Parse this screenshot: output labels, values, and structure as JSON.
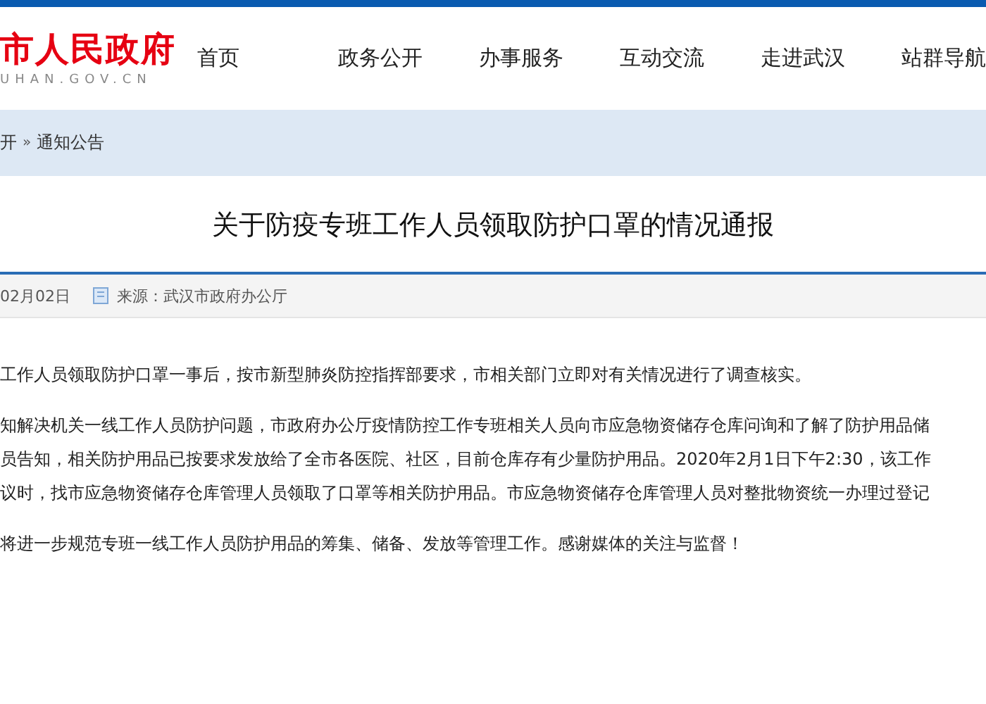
{
  "header": {
    "logo_title": "市人民政府",
    "logo_domain": "UHAN.GOV.CN",
    "nav": [
      {
        "label": "首页"
      },
      {
        "label": "政务公开"
      },
      {
        "label": "办事服务"
      },
      {
        "label": "互动交流"
      },
      {
        "label": "走进武汉"
      },
      {
        "label": "站群导航"
      }
    ]
  },
  "breadcrumb": [
    "开",
    "通知公告"
  ],
  "breadcrumb_separator": "»",
  "article": {
    "title": "关于防疫专班工作人员领取防护口罩的情况通报",
    "date": "02月02日",
    "source": "来源：武汉市政府办公厅",
    "paragraphs": [
      [
        "工作人员领取防护口罩一事后，按市新型肺炎防控指挥部要求，市相关部门立即对有关情况进行了调查核实。"
      ],
      [
        "知解决机关一线工作人员防护问题，市政府办公厅疫情防控工作专班相关人员向市应急物资储存仓库问询和了解了防护用品储",
        "员告知，相关防护用品已按要求发放给了全市各医院、社区，目前仓库存有少量防护用品。2020年2月1日下午2:30，该工作",
        "议时，找市应急物资储存仓库管理人员领取了口罩等相关防护用品。市应急物资储存仓库管理人员对整批物资统一办理过登记"
      ],
      [
        "将进一步规范专班一线工作人员防护用品的筹集、储备、发放等管理工作。感谢媒体的关注与监督！"
      ]
    ]
  }
}
